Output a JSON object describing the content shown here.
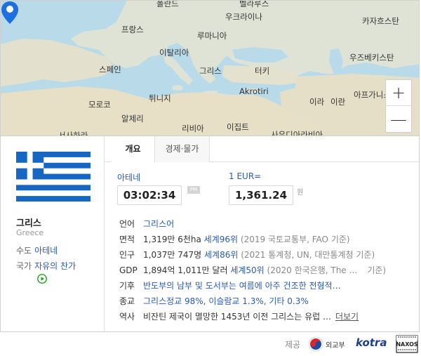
{
  "map": {
    "labels": {
      "poland": "폴란드",
      "belarus": "벨라루스",
      "ukraine": "우크라이나",
      "kazakhstan": "카자흐스탄",
      "france": "프랑스",
      "romania": "루마니아",
      "italy": "이탈리아",
      "spain": "스페인",
      "greece": "그리스",
      "turkey": "터키",
      "uzbekistan": "우즈베키스탄",
      "akrotiri": "Akrotiri",
      "morocco": "모로코",
      "tunisia": "튀니지",
      "iran": "이란",
      "afghanistan": "아프가니스",
      "algeria": "알제리",
      "libya": "리비아",
      "egypt": "이집트",
      "saudi": "사우디아라비아",
      "western_sahara": "서사하라",
      "iraq": "이라"
    },
    "zoom_in": "+",
    "zoom_out": "—"
  },
  "country": {
    "name_ko": "그리스",
    "name_en": "Greece",
    "capital_label": "수도",
    "capital_value": "아테네",
    "anthem_label": "국가",
    "anthem_value": "자유의 찬가"
  },
  "tabs": {
    "overview": "개요",
    "economy": "경제·물가"
  },
  "time": {
    "city": "아테네",
    "clock": "03:02:34",
    "ampm": "PM"
  },
  "exchange": {
    "label": "1 EUR=",
    "value": "1,361.24",
    "unit": "원"
  },
  "details": {
    "language": {
      "key": "언어",
      "value": "그리스어"
    },
    "area": {
      "key": "면적",
      "value": "1,319만 6천ha",
      "rank": "세계96위",
      "source": "(2019 국토교통부, FAO 기준)"
    },
    "population": {
      "key": "인구",
      "value": "1,037만 747명",
      "rank": "세계86위",
      "source": "(2021 통계청, UN, 대만통계청 기준)"
    },
    "gdp": {
      "key": "GDP",
      "value": "1,894억 1,011만 달러",
      "rank": "세계50위",
      "source": "(2020 한국은행, The …",
      "source_end": "기준)"
    },
    "climate": {
      "key": "기후",
      "value": "반도부의 남부 및 도서부는 여름에 아주 건조한 전형적…"
    },
    "religion": {
      "key": "종교",
      "value": "그리스정교 98%, 이슬람교 1.3%, 기타 0.3%"
    },
    "history": {
      "key": "역사",
      "value": "비잔틴 제국이 멸망한 1453년 이전 그리스는 유럽 …",
      "more": "더보기"
    }
  },
  "footer": {
    "provider_label": "제공",
    "mofa": "외교부",
    "kotra": "kotra",
    "naxos": "NAXOS"
  },
  "colors": {
    "link": "#2a5ab8",
    "flag_blue": "#1666c4",
    "pin": "#1e6fe0"
  }
}
